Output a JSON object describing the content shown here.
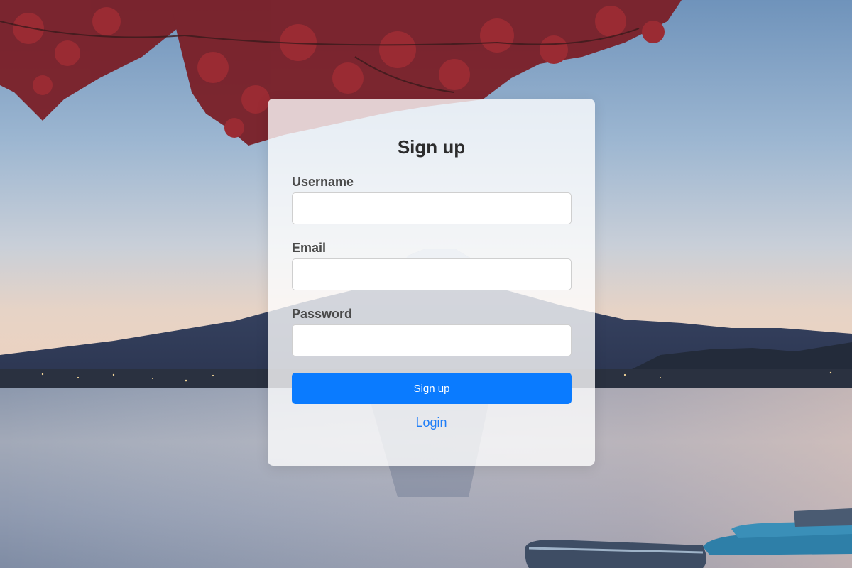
{
  "form": {
    "title": "Sign up",
    "username_label": "Username",
    "username_value": "",
    "email_label": "Email",
    "email_value": "",
    "password_label": "Password",
    "password_value": "",
    "submit_label": "Sign up",
    "login_link": "Login"
  },
  "colors": {
    "accent": "#0a7bff",
    "link": "#1f7ef7",
    "title": "#2d2d2d",
    "label": "#4a4a4a"
  }
}
